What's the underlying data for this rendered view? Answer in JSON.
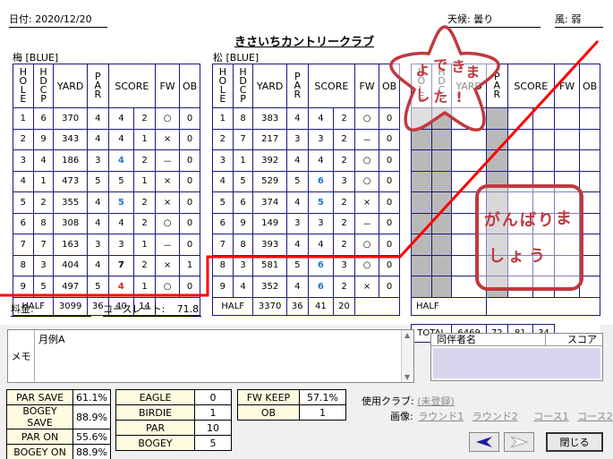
{
  "header": {
    "date": "日付: 2020/12/20",
    "weather": "天候: 曇り",
    "wind": "風: 弱"
  },
  "club": "きさいちカントリークラブ",
  "col_headers": {
    "hole": "HOLE",
    "hdcp": "HDCP",
    "yard": "YARD",
    "par": "PAR",
    "score": "SCORE",
    "fw": "FW",
    "ob": "OB"
  },
  "course1": {
    "tee": "梅 [BLUE]",
    "rows": [
      {
        "hole": "1",
        "hdcp": "6",
        "yard": "370",
        "par": "4",
        "score": "4",
        "putts": "2",
        "fw": "○",
        "ob": "0",
        "cls": ""
      },
      {
        "hole": "2",
        "hdcp": "9",
        "yard": "343",
        "par": "4",
        "score": "4",
        "putts": "1",
        "fw": "×",
        "ob": "0",
        "cls": ""
      },
      {
        "hole": "3",
        "hdcp": "4",
        "yard": "186",
        "par": "3",
        "score": "4",
        "putts": "2",
        "fw": "－",
        "ob": "0",
        "cls": "blue"
      },
      {
        "hole": "4",
        "hdcp": "1",
        "yard": "473",
        "par": "5",
        "score": "5",
        "putts": "1",
        "fw": "×",
        "ob": "0",
        "cls": ""
      },
      {
        "hole": "5",
        "hdcp": "2",
        "yard": "355",
        "par": "4",
        "score": "5",
        "putts": "2",
        "fw": "×",
        "ob": "0",
        "cls": "blue"
      },
      {
        "hole": "6",
        "hdcp": "8",
        "yard": "308",
        "par": "4",
        "score": "4",
        "putts": "2",
        "fw": "○",
        "ob": "0",
        "cls": ""
      },
      {
        "hole": "7",
        "hdcp": "7",
        "yard": "163",
        "par": "3",
        "score": "3",
        "putts": "1",
        "fw": "－",
        "ob": "0",
        "cls": ""
      },
      {
        "hole": "8",
        "hdcp": "3",
        "yard": "404",
        "par": "4",
        "score": "7",
        "putts": "2",
        "fw": "×",
        "ob": "1",
        "cls": "blk"
      },
      {
        "hole": "9",
        "hdcp": "5",
        "yard": "497",
        "par": "5",
        "score": "4",
        "putts": "1",
        "fw": "○",
        "ob": "0",
        "cls": "red"
      }
    ],
    "half": {
      "label": "HALF",
      "yard": "3099",
      "par": "36",
      "score": "40",
      "putts": "14"
    }
  },
  "course2": {
    "tee": "松 [BLUE]",
    "rows": [
      {
        "hole": "1",
        "hdcp": "8",
        "yard": "383",
        "par": "4",
        "score": "4",
        "putts": "2",
        "fw": "○",
        "ob": "0",
        "cls": ""
      },
      {
        "hole": "2",
        "hdcp": "7",
        "yard": "217",
        "par": "3",
        "score": "3",
        "putts": "2",
        "fw": "－",
        "ob": "0",
        "cls": ""
      },
      {
        "hole": "3",
        "hdcp": "1",
        "yard": "392",
        "par": "4",
        "score": "4",
        "putts": "2",
        "fw": "○",
        "ob": "0",
        "cls": ""
      },
      {
        "hole": "4",
        "hdcp": "5",
        "yard": "529",
        "par": "5",
        "score": "6",
        "putts": "3",
        "fw": "○",
        "ob": "0",
        "cls": "blue"
      },
      {
        "hole": "5",
        "hdcp": "6",
        "yard": "374",
        "par": "4",
        "score": "5",
        "putts": "2",
        "fw": "×",
        "ob": "0",
        "cls": "blue"
      },
      {
        "hole": "6",
        "hdcp": "9",
        "yard": "149",
        "par": "3",
        "score": "3",
        "putts": "2",
        "fw": "－",
        "ob": "0",
        "cls": ""
      },
      {
        "hole": "7",
        "hdcp": "8",
        "yard": "393",
        "par": "4",
        "score": "4",
        "putts": "2",
        "fw": "○",
        "ob": "0",
        "cls": ""
      },
      {
        "hole": "8",
        "hdcp": "3",
        "yard": "581",
        "par": "5",
        "score": "6",
        "putts": "3",
        "fw": "○",
        "ob": "0",
        "cls": "blue"
      },
      {
        "hole": "9",
        "hdcp": "4",
        "yard": "352",
        "par": "4",
        "score": "6",
        "putts": "2",
        "fw": "×",
        "ob": "0",
        "cls": "blue"
      }
    ],
    "half": {
      "label": "HALF",
      "yard": "3370",
      "par": "36",
      "score": "41",
      "putts": "20"
    }
  },
  "course3": {
    "half_label": "HALF",
    "total": {
      "label": "TOTAL",
      "yard": "6469",
      "par": "72",
      "score": "81",
      "putts": "34"
    }
  },
  "footer": {
    "fee_label": "料金:",
    "rating_label": "コースレート:",
    "rating_value": "71.8"
  },
  "stamps": {
    "sakura": [
      "よ",
      "で",
      "き",
      "ま",
      "し",
      "た",
      "!"
    ],
    "note": [
      "が",
      "ん",
      "ば",
      "り",
      "ま",
      "し",
      "ょ",
      "う"
    ]
  },
  "memo": {
    "label": "メモ",
    "text": "月例A"
  },
  "companions": {
    "col_name": "同伴者名",
    "col_score": "スコア"
  },
  "stats1": [
    {
      "label": "PAR SAVE",
      "value": "61.1%"
    },
    {
      "label": "BOGEY SAVE",
      "value": "88.9%"
    },
    {
      "label": "PAR ON",
      "value": "55.6%"
    },
    {
      "label": "BOGEY ON",
      "value": "88.9%"
    }
  ],
  "stats2": [
    {
      "label": "EAGLE",
      "value": "0"
    },
    {
      "label": "BIRDIE",
      "value": "1"
    },
    {
      "label": "PAR",
      "value": "10"
    },
    {
      "label": "BOGEY",
      "value": "5"
    }
  ],
  "stats3": [
    {
      "label": "FW KEEP",
      "value": "57.1%"
    },
    {
      "label": "OB",
      "value": "1"
    }
  ],
  "clubs": {
    "label": "使用クラブ:",
    "value": "(未登録)"
  },
  "images": {
    "label": "画像:",
    "links": [
      "ラウンド1",
      "ラウンド2",
      "コース1",
      "コース2"
    ]
  },
  "buttons": {
    "prev_icon": "arrow-left-icon",
    "next_icon": "arrow-right-icon",
    "close": "閉じる",
    "accent": "#1a1aa0"
  },
  "colors": {
    "grid": "#1a1a80",
    "line": "#ff0000",
    "stamp": "#c0393f",
    "companions_bg": "#d7d5ee"
  }
}
